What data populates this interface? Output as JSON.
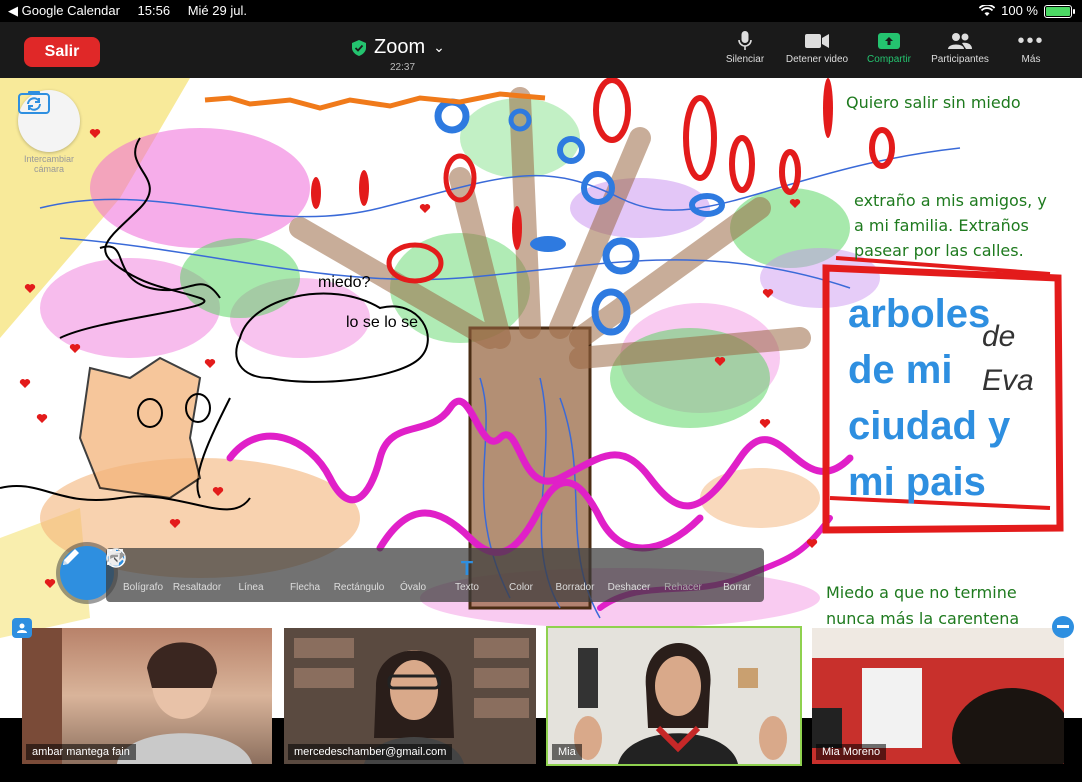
{
  "status_bar": {
    "back_app": "◀ Google Calendar",
    "time": "15:56",
    "date": "Mié 29 jul.",
    "battery": "100 %",
    "battery_level": 1.0
  },
  "meeting": {
    "leave_label": "Salir",
    "title": "Zoom",
    "elapsed": "22:37",
    "controls": [
      {
        "label": "Silenciar",
        "icon": "microphone-icon"
      },
      {
        "label": "Detener video",
        "icon": "video-camera-icon"
      },
      {
        "label": "Compartir",
        "icon": "share-screen-icon"
      },
      {
        "label": "Participantes",
        "icon": "participants-icon"
      },
      {
        "label": "Más",
        "icon": "more-icon"
      }
    ]
  },
  "canvas": {
    "camera_switch_label": "Intercambiar cámara",
    "notes": {
      "quiero": "Quiero salir sin miedo",
      "extrano_1": "extraño a mis amigos, y",
      "extrano_2": "a mi familia. Extraños",
      "extrano_3": "pasear por las calles.",
      "miedo_1": "Miedo a que no termine",
      "miedo_2": "nunca más la carentena"
    },
    "title_lines": [
      "arboles",
      "de mi",
      "ciudad y",
      "mi pais"
    ],
    "de": "de",
    "eva": "Eva",
    "miedo_q": "miedo?",
    "lo_se": "lo se lo se"
  },
  "annotation_tools": [
    {
      "label": "Bolígrafo",
      "icon": "pen-icon"
    },
    {
      "label": "Resaltador",
      "icon": "highlighter-icon"
    },
    {
      "label": "Línea",
      "icon": "line-icon"
    },
    {
      "label": "Flecha",
      "icon": "arrow-icon"
    },
    {
      "label": "Rectángulo",
      "icon": "rectangle-icon"
    },
    {
      "label": "Óvalo",
      "icon": "oval-icon"
    },
    {
      "label": "Texto",
      "icon": "text-icon"
    },
    {
      "label": "Color",
      "icon": "color-icon"
    },
    {
      "label": "Borrador",
      "icon": "eraser-icon"
    },
    {
      "label": "Deshacer",
      "icon": "undo-icon"
    },
    {
      "label": "Rehacer",
      "icon": "redo-icon"
    },
    {
      "label": "Borrar",
      "icon": "trash-icon"
    }
  ],
  "participants": [
    {
      "name": "ambar mantega fain"
    },
    {
      "name": "mercedeschamber@gmail.com"
    },
    {
      "name": "Mia"
    },
    {
      "name": "Mia Moreno"
    }
  ],
  "colors": {
    "leave": "#e02828",
    "share": "#24c36f",
    "accent": "#2e8fe0"
  }
}
